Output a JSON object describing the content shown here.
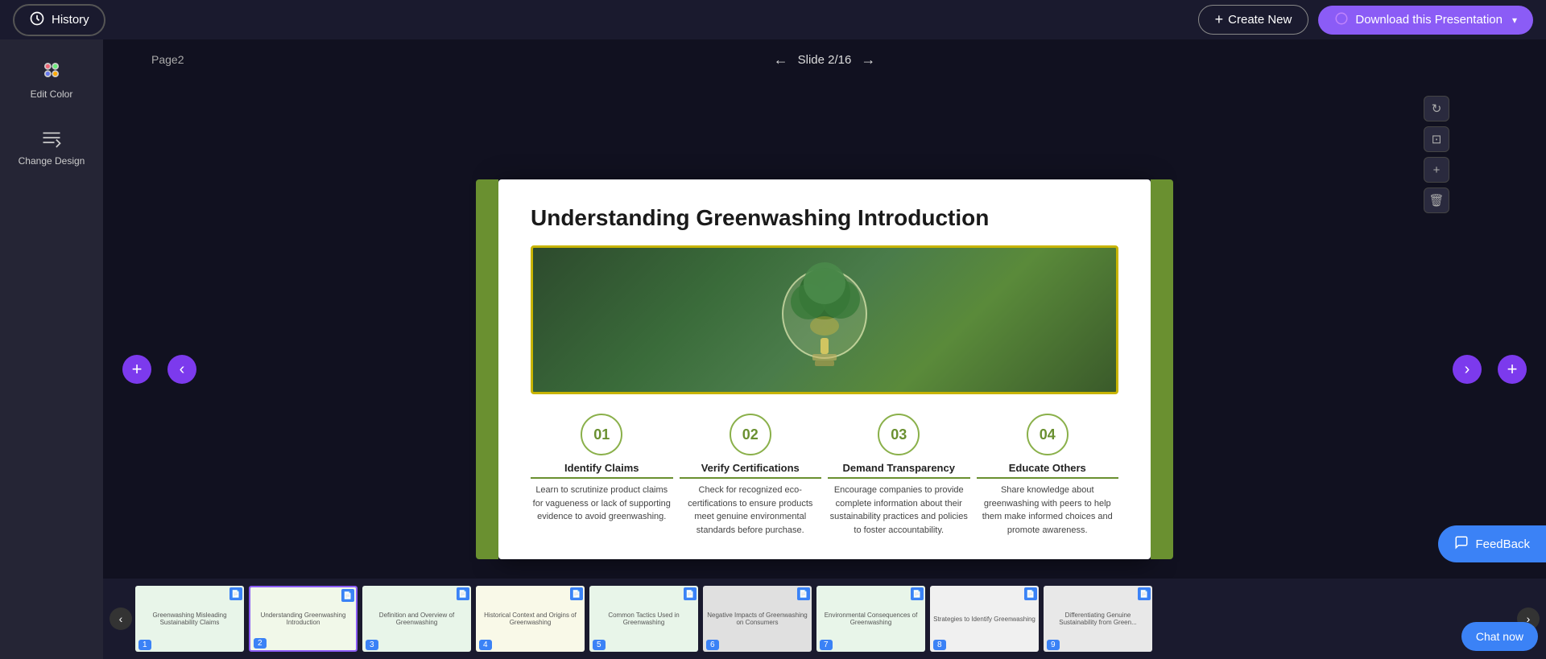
{
  "topbar": {
    "history_label": "History",
    "create_new_label": "Create New",
    "download_label": "Download this Presentation"
  },
  "sidebar": {
    "edit_color_label": "Edit Color",
    "change_design_label": "Change Design"
  },
  "slide_nav": {
    "page_label": "Page2",
    "slide_indicator": "Slide 2/16"
  },
  "slide": {
    "title": "Understanding Greenwashing Introduction",
    "items": [
      {
        "number": "01",
        "title": "Identify Claims",
        "description": "Learn to scrutinize product claims for vagueness or lack of supporting evidence to avoid greenwashing."
      },
      {
        "number": "02",
        "title": "Verify Certifications",
        "description": "Check for recognized eco-certifications to ensure products meet genuine environmental standards before purchase."
      },
      {
        "number": "03",
        "title": "Demand Transparency",
        "description": "Encourage companies to provide complete information about their sustainability practices and policies to foster accountability."
      },
      {
        "number": "04",
        "title": "Educate Others",
        "description": "Share knowledge about greenwashing with peers to help them make informed choices and promote awareness."
      }
    ]
  },
  "thumbnails": [
    {
      "number": "1",
      "label": "Greenwashing Misleading Sustainability Claims",
      "active": false,
      "bg": "#e8f5e9"
    },
    {
      "number": "2",
      "label": "Understanding Greenwashing Introduction",
      "active": true,
      "bg": "#f1f8e9"
    },
    {
      "number": "3",
      "label": "Definition and Overview of Greenwashing",
      "active": false,
      "bg": "#e8f5e9"
    },
    {
      "number": "4",
      "label": "Historical Context and Origins of Greenwashing",
      "active": false,
      "bg": "#f9f9e8"
    },
    {
      "number": "5",
      "label": "Common Tactics Used in Greenwashing",
      "active": false,
      "bg": "#e8f5e9"
    },
    {
      "number": "6",
      "label": "Negative Impacts of Greenwashing on Consumers",
      "active": false,
      "bg": "#e8e8e8"
    },
    {
      "number": "7",
      "label": "Environmental Consequences of Greenwashing",
      "active": false,
      "bg": "#e8f5e9"
    },
    {
      "number": "8",
      "label": "Strategies to Identify Greenwashing",
      "active": false,
      "bg": "#f0f0f0"
    },
    {
      "number": "9",
      "label": "Differentiating Genuine Sustainability from Green...",
      "active": false,
      "bg": "#e8e8e8"
    }
  ],
  "feedback": {
    "label": "FeedBack"
  },
  "chat": {
    "label": "Chat now"
  },
  "icons": {
    "history": "⊙",
    "plus": "+",
    "chevron_left": "‹",
    "chevron_right": "›",
    "download": "↓",
    "refresh": "↻",
    "resize": "⊞",
    "zoom_in": "+",
    "trash": "🗑",
    "chat_bubble": "💬",
    "feedback_bubble": "💬"
  }
}
